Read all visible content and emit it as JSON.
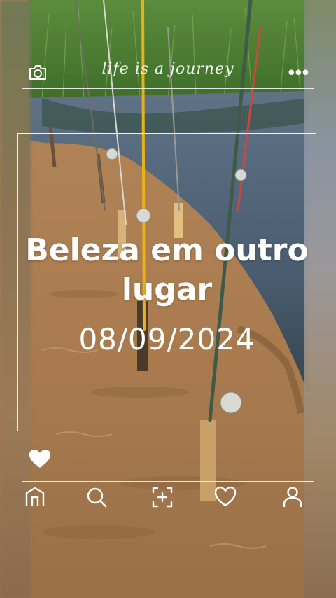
{
  "header": {
    "title": "life is a journey",
    "camera_icon": "camera-icon",
    "more_icon": "more-dots-icon",
    "more_label": "•••"
  },
  "post": {
    "headline": "Beleza em outro lugar",
    "date": "08/09/2024"
  },
  "like": {
    "icon": "heart-icon"
  },
  "bottom_nav": {
    "items": [
      {
        "name": "home",
        "icon": "home-icon"
      },
      {
        "name": "search",
        "icon": "search-icon"
      },
      {
        "name": "add",
        "icon": "add-icon"
      },
      {
        "name": "likes",
        "icon": "heart-outline-icon"
      },
      {
        "name": "profile",
        "icon": "profile-icon"
      }
    ]
  },
  "colors": {
    "overlay_text": "#ffffff",
    "rod_yellow": "#e8b21c"
  }
}
